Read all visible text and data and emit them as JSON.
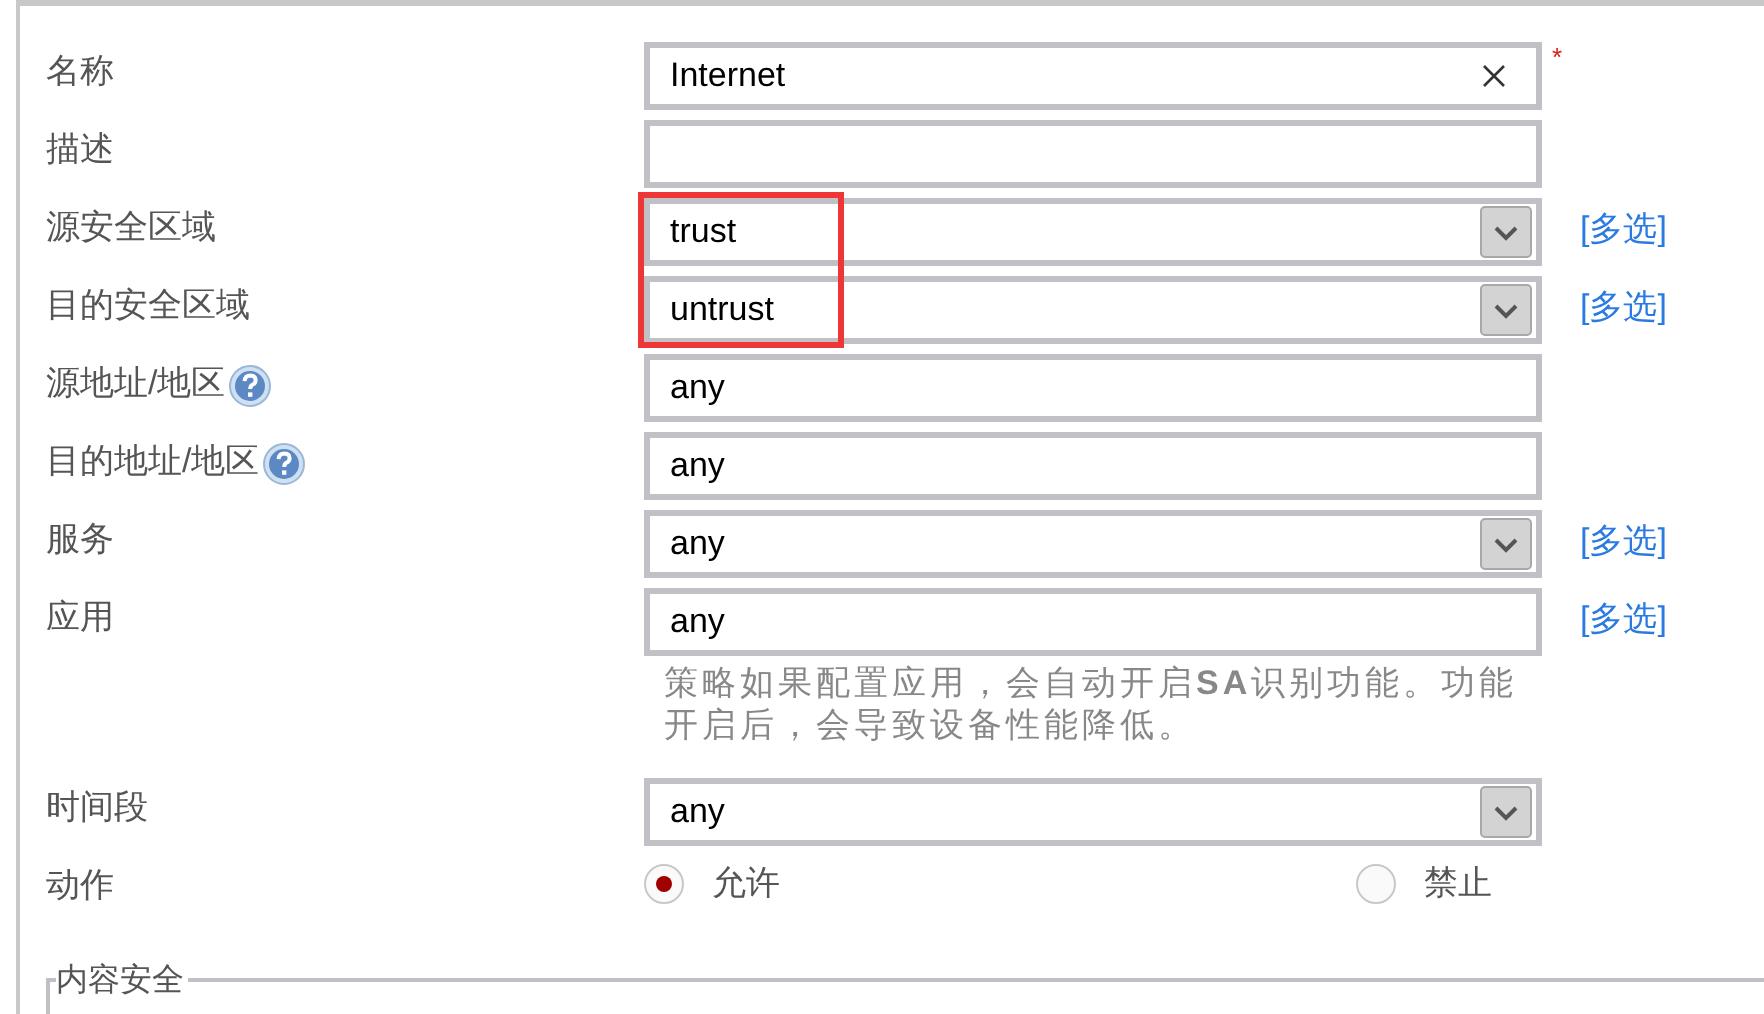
{
  "rows": [
    {
      "label": "名称",
      "kind": "text",
      "value": "Internet",
      "clearable": true,
      "required_mark": "*"
    },
    {
      "label": "描述",
      "kind": "text",
      "value": ""
    },
    {
      "label": "源安全区域",
      "kind": "select",
      "value": "trust",
      "multi_link": "[多选]",
      "highlighted": true
    },
    {
      "label": "目的安全区域",
      "kind": "select",
      "value": "untrust",
      "multi_link": "[多选]",
      "highlighted": true
    },
    {
      "label": "源地址/地区",
      "kind": "text",
      "value": "any",
      "help": true
    },
    {
      "label": "目的地址/地区",
      "kind": "text",
      "value": "any",
      "help": true
    },
    {
      "label": "服务",
      "kind": "select",
      "value": "any",
      "multi_link": "[多选]"
    },
    {
      "label": "应用",
      "kind": "text",
      "value": "any",
      "multi_link": "[多选]",
      "note": "策略如果配置应用，会自动开启**SA**识别功能。功能开启后，会导致设备性能降低。"
    },
    {
      "label": "时间段",
      "kind": "select",
      "value": "any"
    },
    {
      "label": "动作",
      "kind": "radio",
      "options": [
        {
          "label": "允许",
          "selected": true
        },
        {
          "label": "禁止",
          "selected": false
        }
      ]
    }
  ],
  "section": {
    "legend": "内容安全"
  }
}
